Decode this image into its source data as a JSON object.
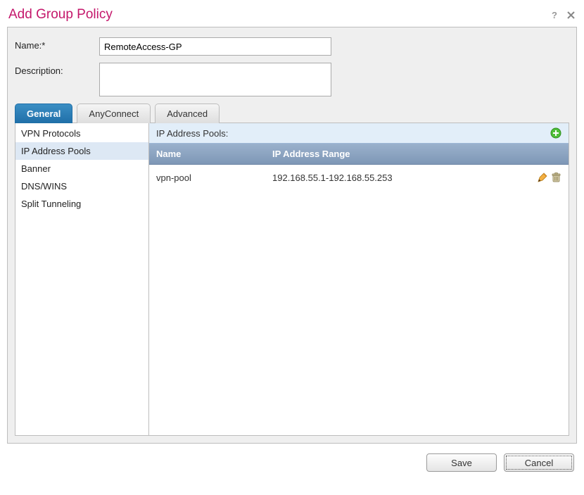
{
  "dialog": {
    "title": "Add Group Policy"
  },
  "form": {
    "name_label": "Name:*",
    "name_value": "RemoteAccess-GP",
    "description_label": "Description:",
    "description_value": ""
  },
  "tabs": [
    {
      "label": "General",
      "active": true
    },
    {
      "label": "AnyConnect",
      "active": false
    },
    {
      "label": "Advanced",
      "active": false
    }
  ],
  "sidebar": {
    "items": [
      {
        "label": "VPN Protocols",
        "selected": false
      },
      {
        "label": "IP Address Pools",
        "selected": true
      },
      {
        "label": "Banner",
        "selected": false
      },
      {
        "label": "DNS/WINS",
        "selected": false
      },
      {
        "label": "Split Tunneling",
        "selected": false
      }
    ]
  },
  "detail": {
    "heading": "IP Address Pools:",
    "columns": {
      "name": "Name",
      "range": "IP Address Range"
    },
    "rows": [
      {
        "name": "vpn-pool",
        "range": "192.168.55.1-192.168.55.253"
      }
    ]
  },
  "buttons": {
    "save": "Save",
    "cancel": "Cancel"
  }
}
